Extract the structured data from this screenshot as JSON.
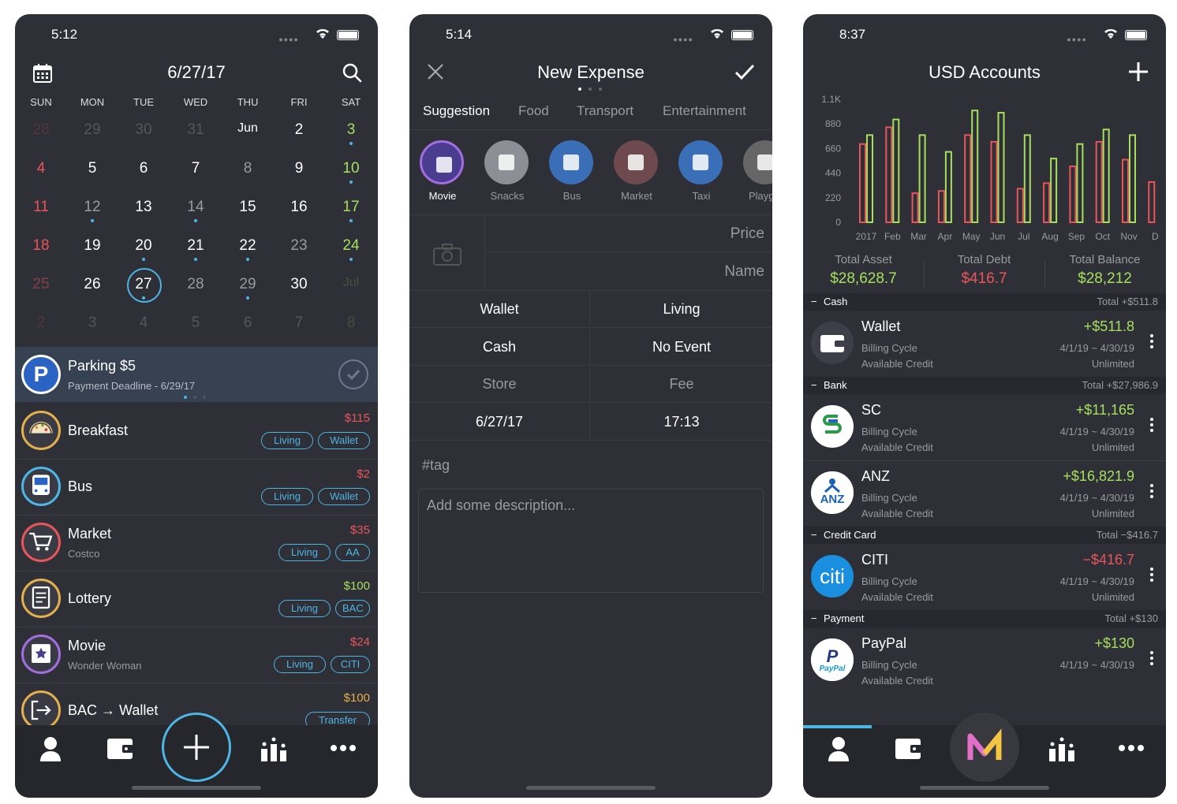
{
  "screen1": {
    "status_time": "5:12",
    "title": "6/27/17",
    "weekdays": [
      "SUN",
      "MON",
      "TUE",
      "WED",
      "THU",
      "FRI",
      "SAT"
    ],
    "weeks": [
      [
        "28",
        "29",
        "30",
        "31",
        "Jun",
        "2",
        "3"
      ],
      [
        "4",
        "5",
        "6",
        "7",
        "8",
        "9",
        "10"
      ],
      [
        "11",
        "12",
        "13",
        "14",
        "15",
        "16",
        "17"
      ],
      [
        "18",
        "19",
        "20",
        "21",
        "22",
        "23",
        "24"
      ],
      [
        "25",
        "26",
        "27",
        "28",
        "29",
        "30",
        "Jul"
      ],
      [
        "2",
        "3",
        "4",
        "5",
        "6",
        "7",
        "8"
      ]
    ],
    "reminder": {
      "title": "Parking $5",
      "subtitle": "Payment Deadline - 6/29/17",
      "icon_letter": "P"
    },
    "transactions": [
      {
        "name": "Breakfast",
        "note": "",
        "amount": "$115",
        "tags": [
          "Living",
          "Wallet"
        ],
        "icon": "taco-icon"
      },
      {
        "name": "Bus",
        "note": "",
        "amount": "$2",
        "tags": [
          "Living",
          "Wallet"
        ],
        "icon": "bus-icon"
      },
      {
        "name": "Market",
        "note": "Costco",
        "amount": "$35",
        "tags": [
          "Living",
          "AA"
        ],
        "icon": "cart-icon"
      },
      {
        "name": "Lottery",
        "note": "",
        "amount": "$100",
        "tags": [
          "Living",
          "BAC"
        ],
        "icon": "ticket-icon"
      },
      {
        "name": "Movie",
        "note": "Wonder Woman",
        "amount": "$24",
        "tags": [
          "Living",
          "CITI"
        ],
        "icon": "movie-icon"
      },
      {
        "name": "BAC → Wallet",
        "note": "",
        "amount": "$100",
        "tags": [
          "Transfer"
        ],
        "icon": "transfer-icon"
      }
    ]
  },
  "screen2": {
    "status_time": "5:14",
    "title": "New Expense",
    "tabs": [
      "Suggestion",
      "Food",
      "Transport",
      "Entertainment"
    ],
    "categories": [
      "Movie",
      "Snacks",
      "Bus",
      "Market",
      "Taxi",
      "Playgro"
    ],
    "price_placeholder": "Price",
    "name_placeholder": "Name",
    "grid": [
      [
        "Wallet",
        "Living"
      ],
      [
        "Cash",
        "No Event"
      ],
      [
        "Store",
        "Fee"
      ],
      [
        "6/27/17",
        "17:13"
      ]
    ],
    "tag_placeholder": "#tag",
    "desc_placeholder": "Add some description..."
  },
  "screen3": {
    "status_time": "8:37",
    "title": "USD Accounts",
    "chart_data": {
      "type": "bar",
      "categories": [
        "2017",
        "Feb",
        "Mar",
        "Apr",
        "May",
        "Jun",
        "Jul",
        "Aug",
        "Sep",
        "Oct",
        "Nov",
        "D"
      ],
      "series": [
        {
          "values": [
            700,
            850,
            260,
            280,
            780,
            720,
            300,
            350,
            500,
            720,
            560,
            360
          ],
          "color": "#e8565a"
        },
        {
          "values": [
            780,
            920,
            780,
            630,
            1000,
            980,
            780,
            570,
            700,
            830,
            780,
            0
          ],
          "color": "#a4e05c"
        }
      ],
      "yticks": [
        "1.1K",
        "880",
        "660",
        "440",
        "220",
        "0"
      ],
      "ylim": [
        0,
        1100
      ]
    },
    "totals": [
      {
        "label": "Total Asset",
        "value": "$28,628.7",
        "color": "#a4e05c"
      },
      {
        "label": "Total Debt",
        "value": "$416.7",
        "color": "#e8565a"
      },
      {
        "label": "Total Balance",
        "value": "$28,212",
        "color": "#a4e05c"
      }
    ],
    "sections": [
      {
        "name": "Cash",
        "total": "Total +$511.8",
        "accounts": [
          {
            "name": "Wallet",
            "amount": "+$511.8",
            "color": "#a4e05c",
            "cycle": "4/1/19 ~ 4/30/19",
            "credit": "Unlimited",
            "logo": "wallet-logo"
          }
        ]
      },
      {
        "name": "Bank",
        "total": "Total +$27,986.9",
        "accounts": [
          {
            "name": "SC",
            "amount": "+$11,165",
            "color": "#a4e05c",
            "cycle": "4/1/19 ~ 4/30/19",
            "credit": "Unlimited",
            "logo": "sc-logo"
          },
          {
            "name": "ANZ",
            "amount": "+$16,821.9",
            "color": "#a4e05c",
            "cycle": "4/1/19 ~ 4/30/19",
            "credit": "Unlimited",
            "logo": "anz-logo"
          }
        ]
      },
      {
        "name": "Credit Card",
        "total": "Total −$416.7",
        "accounts": [
          {
            "name": "CITI",
            "amount": "−$416.7",
            "color": "#e8565a",
            "cycle": "4/1/19 ~ 4/30/19",
            "credit": "Unlimited",
            "logo": "citi-logo"
          }
        ]
      },
      {
        "name": "Payment",
        "total": "Total +$130",
        "accounts": [
          {
            "name": "PayPal",
            "amount": "+$130",
            "color": "#a4e05c",
            "cycle": "4/1/19 ~ 4/30/19",
            "credit": "",
            "logo": "paypal-logo"
          }
        ]
      }
    ],
    "billing_label": "Billing Cycle",
    "credit_label": "Available Credit"
  }
}
